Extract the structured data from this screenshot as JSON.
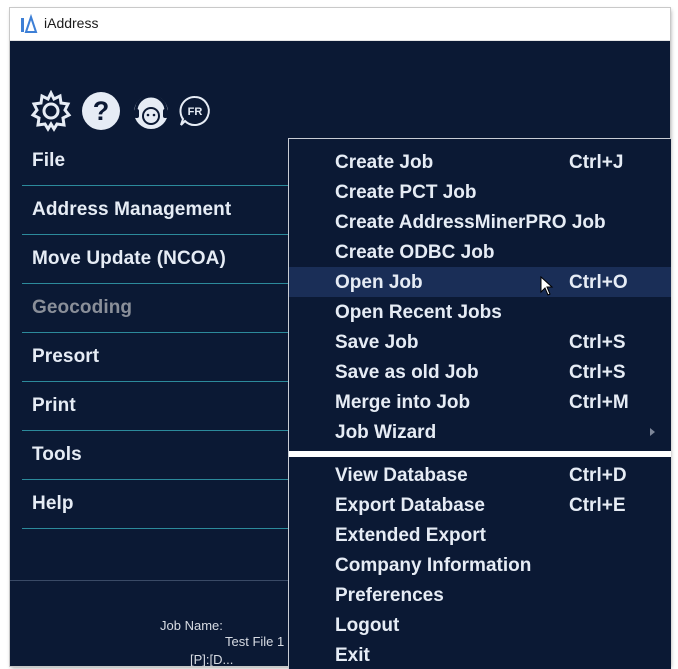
{
  "window": {
    "title": "iAddress"
  },
  "toolbar": {
    "icons": [
      {
        "name": "settings-icon"
      },
      {
        "name": "help-icon",
        "glyph": "?"
      },
      {
        "name": "support-agent-icon"
      },
      {
        "name": "language-fr-icon",
        "label": "FR"
      }
    ]
  },
  "nav": {
    "items": [
      {
        "label": "File",
        "enabled": true
      },
      {
        "label": "Address Management",
        "enabled": true
      },
      {
        "label": "Move Update (NCOA)",
        "enabled": true
      },
      {
        "label": "Geocoding",
        "enabled": false
      },
      {
        "label": "Presort",
        "enabled": true
      },
      {
        "label": "Print",
        "enabled": true
      },
      {
        "label": "Tools",
        "enabled": true
      },
      {
        "label": "Help",
        "enabled": true
      }
    ]
  },
  "footer": {
    "job_name_label": "Job Name:",
    "job_name_value": "Test File 1",
    "job_path": "[P]:[D..."
  },
  "file_menu": {
    "group1": [
      {
        "label": "Create Job",
        "shortcut": "Ctrl+J"
      },
      {
        "label": "Create PCT Job",
        "shortcut": ""
      },
      {
        "label": "Create AddressMinerPRO Job",
        "shortcut": ""
      },
      {
        "label": "Create ODBC Job",
        "shortcut": ""
      },
      {
        "label": "Open Job",
        "shortcut": "Ctrl+O",
        "highlighted": true
      },
      {
        "label": "Open Recent Jobs",
        "shortcut": ""
      },
      {
        "label": "Save Job",
        "shortcut": "Ctrl+S"
      },
      {
        "label": "Save as old Job",
        "shortcut": "Ctrl+S"
      },
      {
        "label": "Merge into Job",
        "shortcut": "Ctrl+M"
      },
      {
        "label": "Job Wizard",
        "shortcut": "",
        "submenu": true
      }
    ],
    "group2": [
      {
        "label": "View Database",
        "shortcut": "Ctrl+D"
      },
      {
        "label": "Export Database",
        "shortcut": "Ctrl+E"
      },
      {
        "label": "Extended Export",
        "shortcut": ""
      },
      {
        "label": "Company Information",
        "shortcut": ""
      },
      {
        "label": "Preferences",
        "shortcut": ""
      },
      {
        "label": "Logout",
        "shortcut": ""
      },
      {
        "label": "Exit",
        "shortcut": ""
      }
    ]
  },
  "colors": {
    "background": "#0b1934",
    "divider": "#2c8a9b",
    "highlight": "#1a2e57",
    "text": "#e6ecf5",
    "disabled_text": "#8a8f99"
  }
}
